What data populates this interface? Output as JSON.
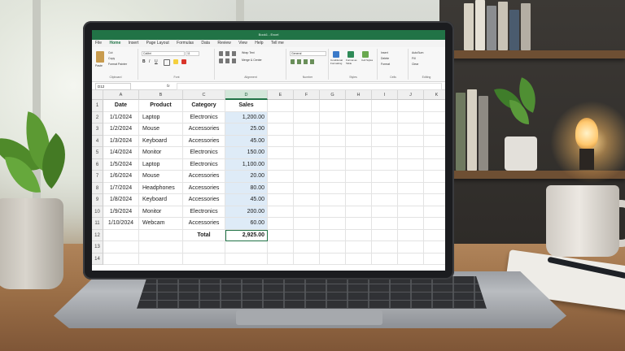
{
  "app": {
    "title": "Book1 - Excel",
    "tabs": [
      "File",
      "Home",
      "Insert",
      "Page Layout",
      "Formulas",
      "Data",
      "Review",
      "View",
      "Help",
      "Tell me"
    ],
    "active_tab": "Home"
  },
  "ribbon": {
    "clipboard": {
      "label": "Clipboard",
      "paste": "Paste",
      "cut": "Cut",
      "copy": "Copy",
      "painter": "Format Painter"
    },
    "font": {
      "label": "Font",
      "name": "Calibri",
      "size": "11"
    },
    "alignment": {
      "label": "Alignment",
      "wrap": "Wrap Text",
      "merge": "Merge & Center"
    },
    "number": {
      "label": "Number",
      "format": "General"
    },
    "styles": {
      "label": "Styles",
      "conditional": "Conditional Formatting",
      "table": "Format as Table",
      "cell": "Cell Styles"
    },
    "cells": {
      "label": "Cells",
      "insert": "Insert",
      "delete": "Delete",
      "format": "Format"
    },
    "editing": {
      "label": "Editing",
      "autosum": "AutoSum",
      "fill": "Fill",
      "clear": "Clear"
    }
  },
  "formula_bar": {
    "name_box": "D12",
    "fx": "fx",
    "content": ""
  },
  "sheet": {
    "columns": [
      "A",
      "B",
      "C",
      "D",
      "E",
      "F",
      "G",
      "H",
      "I",
      "J",
      "K"
    ],
    "row_numbers": [
      "1",
      "2",
      "3",
      "4",
      "5",
      "6",
      "7",
      "8",
      "9",
      "10",
      "11",
      "12",
      "13",
      "14"
    ],
    "headers": {
      "date": "Date",
      "product": "Product",
      "category": "Category",
      "sales": "Sales"
    },
    "rows": [
      {
        "date": "1/1/2024",
        "product": "Laptop",
        "category": "Electronics",
        "sales": "1,200.00"
      },
      {
        "date": "1/2/2024",
        "product": "Mouse",
        "category": "Accessories",
        "sales": "25.00"
      },
      {
        "date": "1/3/2024",
        "product": "Keyboard",
        "category": "Accessories",
        "sales": "45.00"
      },
      {
        "date": "1/4/2024",
        "product": "Monitor",
        "category": "Electronics",
        "sales": "150.00"
      },
      {
        "date": "1/5/2024",
        "product": "Laptop",
        "category": "Electronics",
        "sales": "1,100.00"
      },
      {
        "date": "1/6/2024",
        "product": "Mouse",
        "category": "Accessories",
        "sales": "20.00"
      },
      {
        "date": "1/7/2024",
        "product": "Headphones",
        "category": "Accessories",
        "sales": "80.00"
      },
      {
        "date": "1/8/2024",
        "product": "Keyboard",
        "category": "Accessories",
        "sales": "45.00"
      },
      {
        "date": "1/9/2024",
        "product": "Monitor",
        "category": "Electronics",
        "sales": "200.00"
      },
      {
        "date": "1/10/2024",
        "product": "Webcam",
        "category": "Accessories",
        "sales": "60.00"
      }
    ],
    "total_label": "Total",
    "total_value": "2,925.00",
    "selected_column": "D"
  },
  "colors": {
    "excel_green": "#217346",
    "sales_fill": "#deebf7"
  }
}
